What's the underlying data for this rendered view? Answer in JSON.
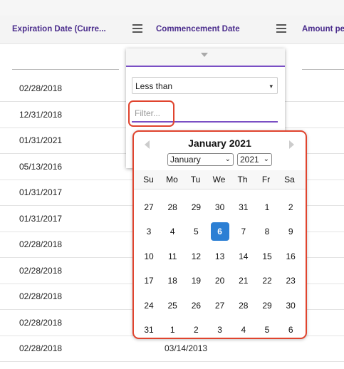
{
  "header": {
    "col1": "Expiration Date (Curre...",
    "col2": "Commencement Date",
    "col3": "Amount pe"
  },
  "rows": [
    {
      "date": "02/28/2018"
    },
    {
      "date": "12/31/2018"
    },
    {
      "date": "01/31/2021"
    },
    {
      "date": "05/13/2016"
    },
    {
      "date": "01/31/2017"
    },
    {
      "date": "01/31/2017"
    },
    {
      "date": "02/28/2018"
    },
    {
      "date": "02/28/2018"
    },
    {
      "date": "02/28/2018"
    },
    {
      "date": "02/28/2018"
    },
    {
      "date": "02/28/2018",
      "commencement": "03/14/2013"
    }
  ],
  "filter": {
    "operator": "Less than",
    "input_placeholder": "Filter...",
    "input_value": "Filter..."
  },
  "datepicker": {
    "title": "January 2021",
    "month_select": "January",
    "year_select": "2021",
    "weekdays": [
      "Su",
      "Mo",
      "Tu",
      "We",
      "Th",
      "Fr",
      "Sa"
    ],
    "weeks": [
      [
        "27",
        "28",
        "29",
        "30",
        "31",
        "1",
        "2"
      ],
      [
        "3",
        "4",
        "5",
        "6",
        "7",
        "8",
        "9"
      ],
      [
        "10",
        "11",
        "12",
        "13",
        "14",
        "15",
        "16"
      ],
      [
        "17",
        "18",
        "19",
        "20",
        "21",
        "22",
        "23"
      ],
      [
        "24",
        "25",
        "26",
        "27",
        "28",
        "29",
        "30"
      ],
      [
        "31",
        "1",
        "2",
        "3",
        "4",
        "5",
        "6"
      ]
    ],
    "selected_day": "6"
  },
  "colors": {
    "header_text": "#4a2c8c",
    "accent_purple": "#7a4fc4",
    "highlight_red": "#e0442e",
    "selected_blue": "#2b7fd4"
  }
}
